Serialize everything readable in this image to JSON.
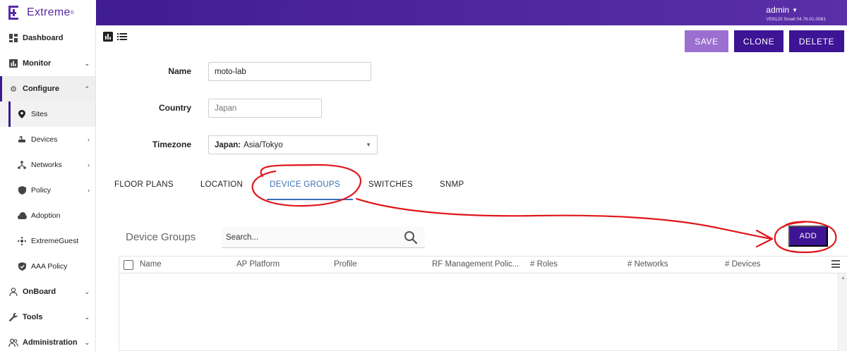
{
  "brand": {
    "name": "Extreme",
    "tm": "®"
  },
  "header": {
    "user": "admin",
    "version": "VE6120 Small 04.76.01.0081"
  },
  "sidebar": {
    "items": [
      {
        "label": "Dashboard",
        "icon": "dashboard-icon"
      },
      {
        "label": "Monitor",
        "icon": "chart-icon"
      },
      {
        "label": "Configure",
        "icon": "gear-icon"
      },
      {
        "label": "Sites",
        "icon": "location-pin-icon"
      },
      {
        "label": "Devices",
        "icon": "device-icon"
      },
      {
        "label": "Networks",
        "icon": "network-icon"
      },
      {
        "label": "Policy",
        "icon": "shield-icon"
      },
      {
        "label": "Adoption",
        "icon": "cloud-icon"
      },
      {
        "label": "ExtremeGuest",
        "icon": "guest-icon"
      },
      {
        "label": "AAA Policy",
        "icon": "shield-check-icon"
      },
      {
        "label": "OnBoard",
        "icon": "user-icon"
      },
      {
        "label": "Tools",
        "icon": "wrench-icon"
      },
      {
        "label": "Administration",
        "icon": "users-icon"
      }
    ]
  },
  "toolbar": {
    "save": "SAVE",
    "clone": "CLONE",
    "delete": "DELETE"
  },
  "form": {
    "name_label": "Name",
    "name_value": "moto-lab",
    "country_label": "Country",
    "country_value": "Japan",
    "timezone_label": "Timezone",
    "timezone_prefix": "Japan:",
    "timezone_value": "Asia/Tokyo"
  },
  "tabs": [
    "FLOOR PLANS",
    "LOCATION",
    "DEVICE GROUPS",
    "SWITCHES",
    "SNMP"
  ],
  "device_groups": {
    "title": "Device Groups",
    "search_placeholder": "Search...",
    "add": "ADD",
    "columns": [
      "Name",
      "AP Platform",
      "Profile",
      "RF Management Polic...",
      "# Roles",
      "# Networks",
      "# Devices"
    ]
  },
  "colors": {
    "accent": "#3d1494",
    "save": "#9b6fd0",
    "tab_active": "#3a6fb7",
    "annotation": "#e0161b"
  }
}
